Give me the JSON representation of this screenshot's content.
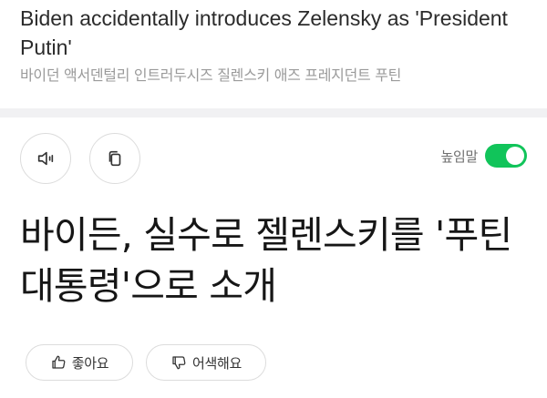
{
  "header": {
    "english_title": "Biden accidentally introduces Zelensky as 'President Putin'",
    "korean_transliteration": "바이던 액서덴털리 인트러두시즈 질렌스키 애즈 프레지던트 푸틴"
  },
  "toolbar": {
    "listen_icon": "speaker-icon",
    "copy_icon": "copy-icon",
    "toggle_label": "높임말",
    "toggle_on": true,
    "toggle_color": "#11c45a"
  },
  "article": {
    "headline": "바이든, 실수로 젤렌스키를 '푸틴 대통령'으로 소개"
  },
  "reactions": {
    "like_label": "좋아요",
    "like_icon": "thumbs-up-icon",
    "awkward_label": "어색해요",
    "awkward_icon": "thumbs-down-icon"
  }
}
